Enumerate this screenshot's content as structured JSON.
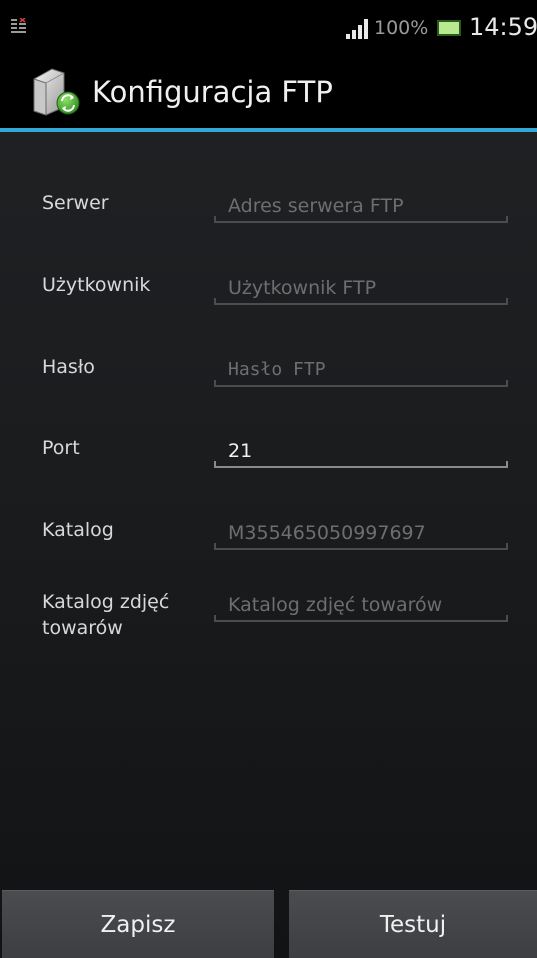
{
  "status_bar": {
    "battery_percent": "100%",
    "time": "14:59",
    "icons": [
      "notification-icon",
      "signal-icon",
      "battery-icon"
    ]
  },
  "action_bar": {
    "title": "Konfiguracja FTP",
    "icon": "ftp-server-sync-icon",
    "accent_color": "#33a8d8"
  },
  "form": {
    "fields": [
      {
        "label": "Serwer",
        "value": "",
        "placeholder": "Adres serwera FTP"
      },
      {
        "label": "Użytkownik",
        "value": "",
        "placeholder": "Użytkownik FTP"
      },
      {
        "label": "Hasło",
        "value": "",
        "placeholder": "Hasło FTP"
      },
      {
        "label": "Port",
        "value": "21",
        "placeholder": ""
      },
      {
        "label": "Katalog",
        "value": "",
        "placeholder": "M355465050997697"
      },
      {
        "label": "Katalog zdjęć towarów",
        "value": "",
        "placeholder": "Katalog zdjęć towarów"
      }
    ]
  },
  "buttons": {
    "save_label": "Zapisz",
    "test_label": "Testuj"
  }
}
